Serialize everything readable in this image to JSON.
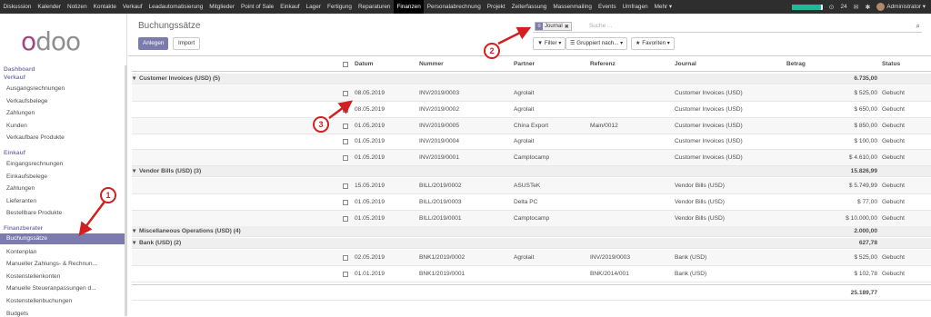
{
  "topbar": {
    "menus": [
      "Diskussion",
      "Kalender",
      "Notizen",
      "Kontakte",
      "Verkauf",
      "Leadautomatisierung",
      "Mitglieder",
      "Point of Sale",
      "Einkauf",
      "Lager",
      "Fertigung",
      "Reparaturen",
      "Finanzen",
      "Personalabrechnung",
      "Projekt",
      "Zeiterfassung",
      "Massenmailing",
      "Events",
      "Umfragen",
      "Mehr ▾"
    ],
    "active_menu": "Finanzen",
    "progress_fraction": 0.95,
    "activity_count": "24",
    "user": "Administrator ▾"
  },
  "sidebar": {
    "logo": "odoo",
    "sections": [
      {
        "label": "Dashboard",
        "items": []
      },
      {
        "label": "Verkauf",
        "items": [
          "Ausgangsrechnungen",
          "Verkaufsbelege",
          "Zahlungen",
          "Kunden",
          "Verkaufbare Produkte"
        ]
      },
      {
        "label": "Einkauf",
        "items": [
          "Eingangsrechnungen",
          "Einkaufsbelege",
          "Zahlungen",
          "Lieferanten",
          "Bestellbare Produkte"
        ]
      },
      {
        "label": "Finanzberater",
        "items": [
          "Buchungssätze",
          "Kontenplan",
          "Manueller Zahlungs- & Rechnun...",
          "Kostenstellenkonten",
          "Manuelle Steueranpassungen d...",
          "Kostenstellenbuchungen",
          "Budgets"
        ]
      }
    ],
    "active_item": "Buchungssätze"
  },
  "control_panel": {
    "title": "Buchungssätze",
    "create_label": "Anlegen",
    "import_label": "Import",
    "facet_value": "Journal",
    "search_placeholder": "Suche ...",
    "filter_label": "Filter ▾",
    "group_label": "Gruppiert nach... ▾",
    "fav_label": "Favoriten ▾"
  },
  "table": {
    "columns": [
      "Datum",
      "Nummer",
      "Partner",
      "Referenz",
      "Journal",
      "Betrag",
      "Status"
    ],
    "groups": [
      {
        "label": "Customer Invoices (USD) (5)",
        "total": "6.735,00",
        "rows": [
          [
            "08.05.2019",
            "INV/2019/0003",
            "Agrolait",
            "",
            "Customer Invoices (USD)",
            "$ 525,00",
            "Gebucht"
          ],
          [
            "08.05.2019",
            "INV/2019/0002",
            "Agrolait",
            "",
            "Customer Invoices (USD)",
            "$ 650,00",
            "Gebucht"
          ],
          [
            "01.05.2019",
            "INV/2019/0005",
            "China Export",
            "Main/0012",
            "Customer Invoices (USD)",
            "$ 850,00",
            "Gebucht"
          ],
          [
            "01.05.2019",
            "INV/2019/0004",
            "Agrolait",
            "",
            "Customer Invoices (USD)",
            "$ 100,00",
            "Gebucht"
          ],
          [
            "01.05.2019",
            "INV/2019/0001",
            "Camptocamp",
            "",
            "Customer Invoices (USD)",
            "$ 4.610,00",
            "Gebucht"
          ]
        ]
      },
      {
        "label": "Vendor Bills (USD) (3)",
        "total": "15.826,99",
        "rows": [
          [
            "15.05.2019",
            "BILL/2019/0002",
            "ASUSTeK",
            "",
            "Vendor Bills (USD)",
            "$ 5.749,99",
            "Gebucht"
          ],
          [
            "01.05.2019",
            "BILL/2019/0003",
            "Delta PC",
            "",
            "Vendor Bills (USD)",
            "$ 77,00",
            "Gebucht"
          ],
          [
            "01.05.2019",
            "BILL/2019/0001",
            "Camptocamp",
            "",
            "Vendor Bills (USD)",
            "$ 10.000,00",
            "Gebucht"
          ]
        ]
      },
      {
        "label": "Miscellaneous Operations (USD) (4)",
        "total": "2.000,00",
        "rows": []
      },
      {
        "label": "Bank (USD) (2)",
        "total": "627,78",
        "rows": [
          [
            "02.05.2019",
            "BNK1/2019/0002",
            "Agrolait",
            "INV/2019/0003",
            "Bank (USD)",
            "$ 525,00",
            "Gebucht"
          ],
          [
            "01.01.2019",
            "BNK1/2019/0001",
            "",
            "BNK/2014/001",
            "Bank (USD)",
            "$ 102,78",
            "Gebucht"
          ]
        ]
      }
    ],
    "grand_total": "25.189,77"
  },
  "annotations": [
    "1",
    "2",
    "3"
  ],
  "colors": {
    "brand": "#7c7bad",
    "annotation": "#d21f1f",
    "topbar": "#2e2e2e"
  }
}
